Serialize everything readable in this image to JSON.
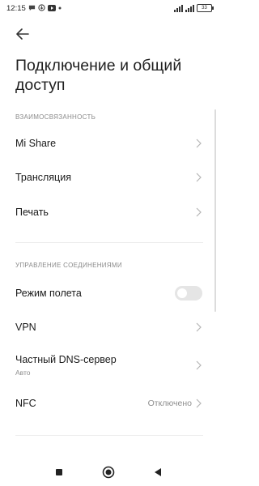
{
  "status_bar": {
    "time": "12:15",
    "notification_icons": [
      "chat-bubble-icon",
      "download-icon",
      "youtube-icon",
      "dot-icon"
    ],
    "battery": "33"
  },
  "header": {
    "title": "Подключение и общий доступ"
  },
  "sections": [
    {
      "header": "ВЗАИМОСВЯЗАННОСТЬ",
      "items": [
        {
          "label": "Mi Share"
        },
        {
          "label": "Трансляция"
        },
        {
          "label": "Печать"
        }
      ]
    },
    {
      "header": "УПРАВЛЕНИЕ СОЕДИНЕНИЯМИ",
      "items": [
        {
          "label": "Режим полета",
          "toggle": false
        },
        {
          "label": "VPN"
        },
        {
          "label": "Частный DNS-сервер",
          "subtitle": "Авто"
        },
        {
          "label": "NFC",
          "value": "Отключено"
        }
      ]
    }
  ],
  "colors": {
    "background": "#ffffff",
    "text": "#1a1a1a",
    "secondary_text": "#8d8d8d",
    "toggle_off": "#e5e5e5"
  }
}
